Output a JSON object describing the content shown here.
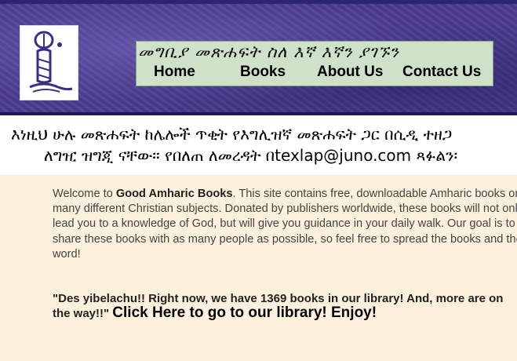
{
  "header": {
    "nav_amharic": "መግቢያ   መጽሐፍት   ስለ እኛ   እኛን ያገኙን",
    "nav": [
      {
        "label": "Home"
      },
      {
        "label": "Books"
      },
      {
        "label": "About Us"
      },
      {
        "label": "Contact Us"
      }
    ]
  },
  "banner": {
    "line1": "እነዚህ ሁሉ መጽሐፍት ከሌሎች ጥቂት የእግሊዝኛ መጽሐፍት ጋር በሲዲ ተዘጋ",
    "line2": "ለግዢ ዝግጂ ናቸው፡፡ የበለጠ ለመረዳት በtexlap@juno.com ጻፉልን፡"
  },
  "welcome": {
    "prefix": "Welcome to ",
    "site_name": "Good Amharic Books",
    "body": ". This site contains free, downloadable Amharic books on many different Christian subjects. Donated by publishers worldwide, these books will not only lead you to a knowledge of God, but will give you guidance in your daily walk. Our goal is to share these books with as many people as possible, so feel free to spread the books and the word!"
  },
  "announcement": {
    "text": "\"Des yibelachu!! Right now, we have 1369 books in our library! And, more are on the way!!\"",
    "link_label": "Click Here to go to our library! Enjoy!"
  },
  "colors": {
    "header_bg": "#4b3c8f",
    "nav_box_bg": "#cfe1c9",
    "page_bg": "#fdf1de"
  }
}
